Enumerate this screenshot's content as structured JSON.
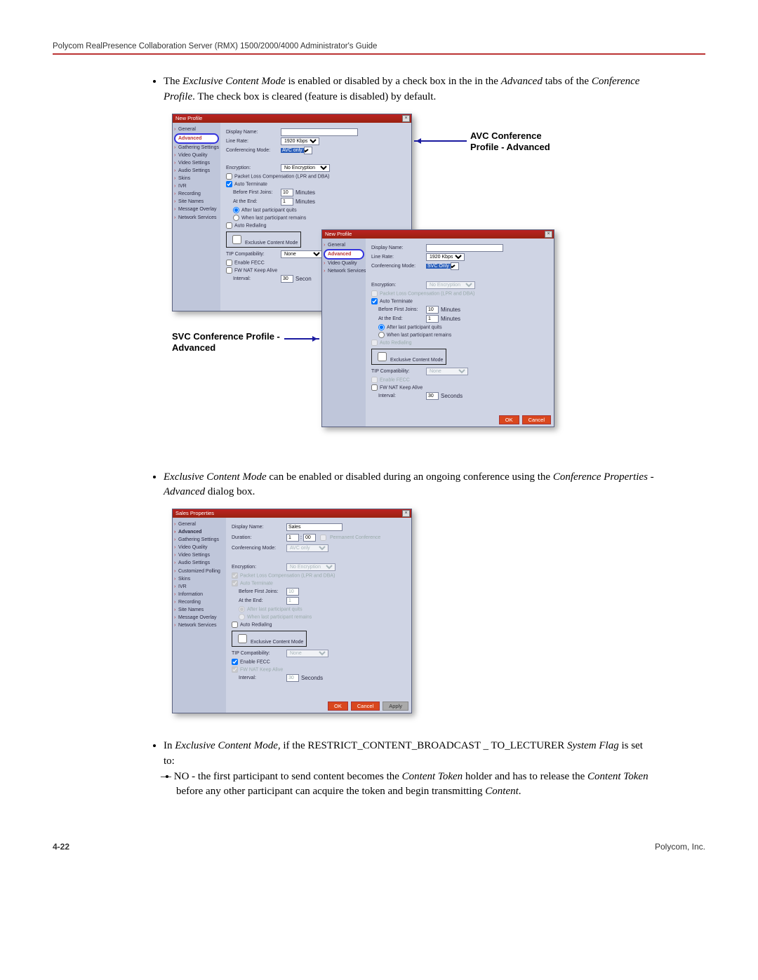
{
  "header": "Polycom RealPresence Collaboration Server (RMX) 1500/2000/4000 Administrator's Guide",
  "footer_left": "4-22",
  "footer_right": "Polycom, Inc.",
  "bullet1_a": "The ",
  "bullet1_b": "Exclusive Content Mode",
  "bullet1_c": " is enabled or disabled by a check box in the in the ",
  "bullet1_d": "Advanced",
  "bullet1_e": " tabs of the ",
  "bullet1_f": "Conference Profile",
  "bullet1_g": ". The check box is cleared (feature is disabled) by default.",
  "bullet2_a": "Exclusive Content Mode",
  "bullet2_b": " can be enabled or disabled during an ongoing conference using the ",
  "bullet2_c": "Conference Properties - Advanced",
  "bullet2_d": " dialog box.",
  "bullet3_a": "In ",
  "bullet3_b": "Exclusive Content Mode,",
  "bullet3_c": " if the RESTRICT_CONTENT_BROADCAST _ TO_LECTURER ",
  "bullet3_d": "System Flag",
  "bullet3_e": " is set to:",
  "sub1_a": "NO - the first participant to send content becomes the ",
  "sub1_b": "Content Token",
  "sub1_c": " holder and has to release the ",
  "sub1_d": "Content Token",
  "sub1_e": " before any other participant can acquire the token and begin transmitting ",
  "sub1_f": "Content",
  "sub1_g": ".",
  "callout_avc_1": "AVC Conference",
  "callout_avc_2": "Profile - Advanced",
  "callout_svc_1": "SVC Conference Profile -",
  "callout_svc_2": "Advanced",
  "dlg1": {
    "title": "New Profile",
    "sidebar": [
      "General",
      "Advanced",
      "Gathering Settings",
      "Video Quality",
      "Video Settings",
      "Audio Settings",
      "Skins",
      "IVR",
      "Recording",
      "Site Names",
      "Message Overlay",
      "Network Services"
    ],
    "display_name_lbl": "Display Name:",
    "line_rate_lbl": "Line Rate:",
    "line_rate_val": "1920 Kbps",
    "conf_mode_lbl": "Conferencing Mode:",
    "conf_mode_val": "AVC only",
    "encryption_lbl": "Encryption:",
    "encryption_val": "No Encryption",
    "plc": "Packet Loss Compensation (LPR and DBA)",
    "auto_term": "Auto Terminate",
    "before_first": "Before First Joins:",
    "before_first_val": "10",
    "minutes": "Minutes",
    "at_end": "At the End:",
    "at_end_val": "1",
    "after_last": "After last participant quits",
    "when_last": "When last participant remains",
    "auto_redial": "Auto Redialing",
    "ecm": "Exclusive Content Mode",
    "tip_lbl": "TIP Compatibility:",
    "tip_val": "None",
    "enable_fecc": "Enable FECC",
    "fw_nat": "FW NAT Keep Alive",
    "interval_lbl": "Interval:",
    "interval_val": "30",
    "seconds": "Secon"
  },
  "dlg2": {
    "title": "New Profile",
    "sidebar": [
      "General",
      "Advanced",
      "Video Quality",
      "Network Services"
    ],
    "display_name_lbl": "Display Name:",
    "line_rate_lbl": "Line Rate:",
    "line_rate_val": "1920 Kbps",
    "conf_mode_lbl": "Conferencing Mode:",
    "conf_mode_val": "SVC Only",
    "encryption_lbl": "Encryption:",
    "encryption_val": "No Encryption",
    "plc": "Packet Loss Compensation (LPR and DBA)",
    "auto_term": "Auto Terminate",
    "before_first": "Before First Joins:",
    "before_first_val": "10",
    "minutes": "Minutes",
    "at_end": "At the End:",
    "at_end_val": "1",
    "after_last": "After last participant quits",
    "when_last": "When last participant remains",
    "auto_redial": "Auto Redialing",
    "ecm": "Exclusive Content Mode",
    "tip_lbl": "TIP Compatibility:",
    "tip_val": "None",
    "enable_fecc": "Enable FECC",
    "fw_nat": "FW NAT Keep Alive",
    "interval_lbl": "Interval:",
    "interval_val": "30",
    "seconds": "Seconds",
    "ok": "OK",
    "cancel": "Cancel"
  },
  "dlg3": {
    "title": "Sales Properties",
    "sidebar": [
      "General",
      "Advanced",
      "Gathering Settings",
      "Video Quality",
      "Video Settings",
      "Audio Settings",
      "Customized Polling",
      "Skins",
      "IVR",
      "Information",
      "Recording",
      "Site Names",
      "Message Overlay",
      "Network Services"
    ],
    "display_name_lbl": "Display Name:",
    "display_name_val": "Sales",
    "duration_lbl": "Duration:",
    "duration_h": "1",
    "duration_m": "00",
    "permanent": "Permanent Conference",
    "conf_mode_lbl": "Conferencing Mode:",
    "conf_mode_val": "AVC only",
    "encryption_lbl": "Encryption:",
    "encryption_val": "No Encryption",
    "plc": "Packet Loss Compensation (LPR and DBA)",
    "auto_term": "Auto Terminate",
    "before_first": "Before First Joins:",
    "before_first_val": "10",
    "at_end": "At the End:",
    "at_end_val": "1",
    "after_last": "After last participant quits",
    "when_last": "When last participant remains",
    "auto_redial": "Auto Redialing",
    "ecm": "Exclusive Content Mode",
    "tip_lbl": "TIP Compatibility:",
    "tip_val": "None",
    "enable_fecc": "Enable FECC",
    "fw_nat": "FW NAT Keep Alive",
    "interval_lbl": "Interval:",
    "interval_val": "30",
    "seconds": "Seconds",
    "ok": "OK",
    "cancel": "Cancel",
    "apply": "Apply"
  }
}
